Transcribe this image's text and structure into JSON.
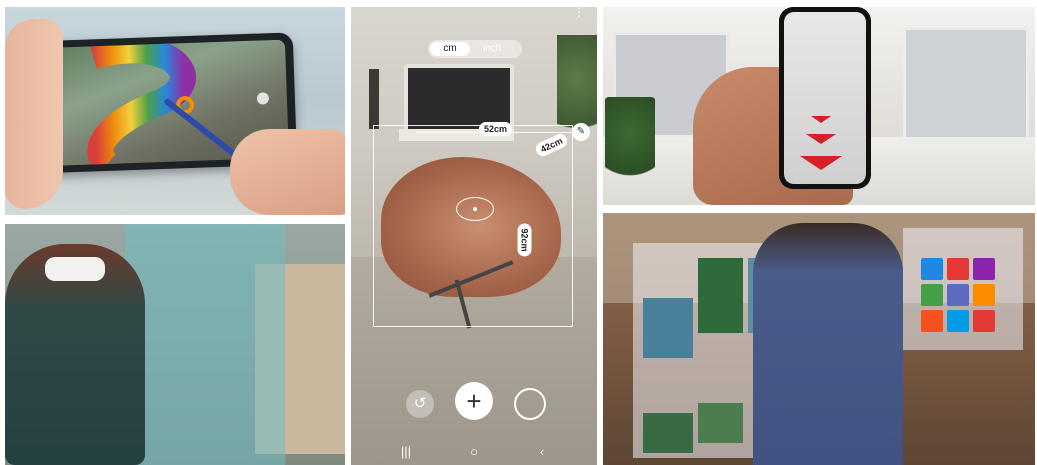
{
  "measure_app": {
    "units": [
      "cm",
      "inch"
    ],
    "selected_unit": "cm",
    "labels": {
      "width": "52cm",
      "depth": "42cm",
      "height": "92cm"
    },
    "controls": {
      "reset_icon": "reset-icon",
      "add_icon": "plus-icon",
      "capture_icon": "circle-icon"
    },
    "nav": {
      "recents": "|||",
      "home": "○",
      "back": "‹"
    }
  },
  "colors": {
    "nav_arrow_red": "#d61f26",
    "pen_blue": "#2f4aa8",
    "chair_brown": "#a5654a"
  }
}
